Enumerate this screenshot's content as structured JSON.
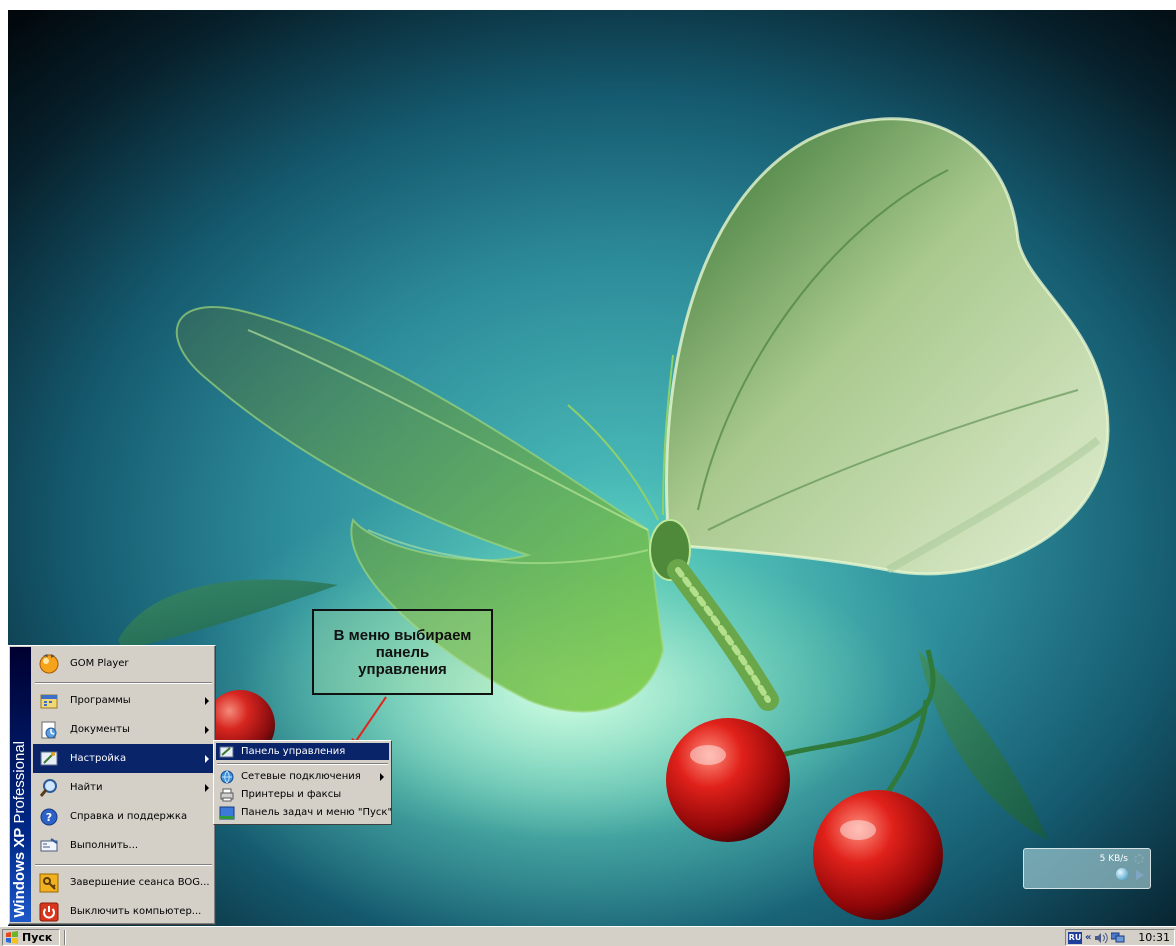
{
  "annotation": {
    "lines": [
      "В меню выбираем",
      "панель",
      "управления"
    ]
  },
  "net_widget": {
    "speed": "5 KB/s"
  },
  "start_menu": {
    "banner": {
      "windows": "Windows XP",
      "edition": "Professional"
    },
    "pinned": {
      "label": "GOM Player",
      "icon": "gom-player-icon"
    },
    "items": [
      {
        "label": "Программы",
        "icon": "programs-icon",
        "submenu": true
      },
      {
        "label": "Документы",
        "icon": "documents-icon",
        "submenu": true
      },
      {
        "label": "Настройка",
        "icon": "settings-icon",
        "submenu": true,
        "active": true
      },
      {
        "label": "Найти",
        "icon": "search-icon",
        "submenu": true
      },
      {
        "label": "Справка и поддержка",
        "icon": "help-icon",
        "submenu": false
      },
      {
        "label": "Выполнить...",
        "icon": "run-icon",
        "submenu": false
      }
    ],
    "footer": [
      {
        "label": "Завершение сеанса BOG...",
        "icon": "logoff-key-icon"
      },
      {
        "label": "Выключить компьютер...",
        "icon": "power-icon"
      }
    ]
  },
  "settings_submenu": {
    "items": [
      {
        "label": "Панель управления",
        "icon": "control-panel-icon",
        "active": true
      },
      {
        "label": "Сетевые подключения",
        "icon": "network-connections-icon",
        "submenu": true
      },
      {
        "label": "Принтеры и факсы",
        "icon": "printers-icon"
      },
      {
        "label": "Панель задач и меню \"Пуск\"",
        "icon": "taskbar-icon"
      }
    ]
  },
  "taskbar": {
    "start_label": "Пуск",
    "language": "RU",
    "expand": "«",
    "clock": "10:31"
  },
  "colors": {
    "highlight": "#0a246a",
    "menu_face": "#d4d0c8",
    "arrow": "#e0261b"
  }
}
